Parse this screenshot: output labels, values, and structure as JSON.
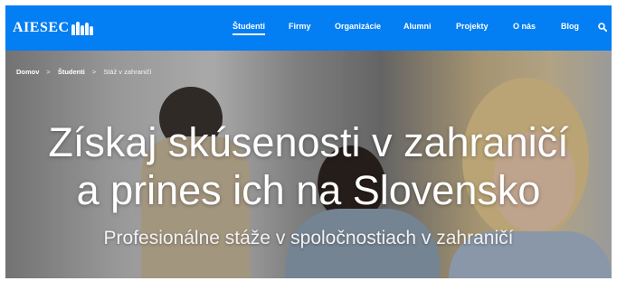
{
  "brand": {
    "logo_text": "AIESEC",
    "accent": "#037ef3"
  },
  "nav": {
    "items": [
      {
        "label": "Študenti",
        "active": true
      },
      {
        "label": "Firmy",
        "active": false
      },
      {
        "label": "Organizácie",
        "active": false
      },
      {
        "label": "Alumni",
        "active": false
      },
      {
        "label": "Projekty",
        "active": false
      },
      {
        "label": "O nás",
        "active": false
      },
      {
        "label": "Blog",
        "active": false
      }
    ],
    "search_icon": "search-icon"
  },
  "breadcrumb": {
    "items": [
      "Domov",
      "Študenti",
      "Stáž v zahraničí"
    ],
    "separator": ">"
  },
  "hero": {
    "title_line1": "Získaj skúsenosti v zahraničí",
    "title_line2": "a prines ich na Slovensko",
    "subtitle": "Profesionálne stáže v spoločnostiach v zahraničí"
  }
}
